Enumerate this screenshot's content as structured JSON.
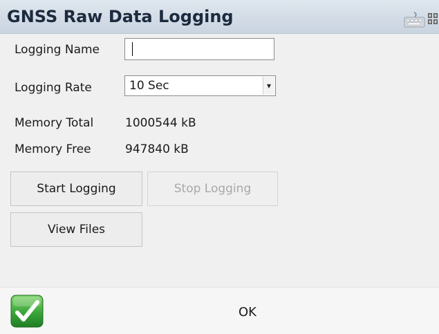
{
  "window": {
    "title": "GNSS Raw Data Logging"
  },
  "titlebar_icons": [
    "keyboard-icon",
    "menu-grid-icon"
  ],
  "form": {
    "logging_name": {
      "label": "Logging Name",
      "value": "",
      "placeholder": ""
    },
    "logging_rate": {
      "label": "Logging Rate",
      "selected": "10 Sec"
    },
    "memory_total": {
      "label": "Memory Total",
      "value": "1000544 kB"
    },
    "memory_free": {
      "label": "Memory Free",
      "value": "947840 kB"
    }
  },
  "buttons": {
    "start_logging": "Start Logging",
    "stop_logging": "Stop Logging",
    "view_files": "View Files"
  },
  "footer": {
    "ok_label": "OK"
  },
  "colors": {
    "titlebar": "#d4dde8",
    "title_text": "#1c2a3e",
    "ok_green": "#2f9d34",
    "disabled_text": "#a8a8a8"
  }
}
